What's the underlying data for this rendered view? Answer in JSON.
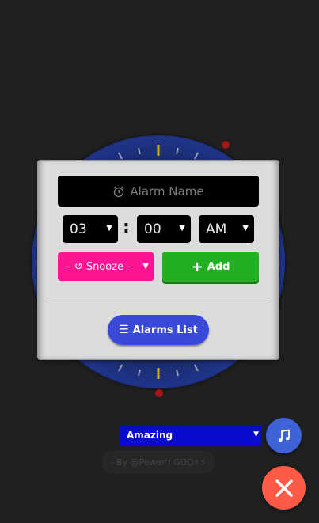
{
  "alarm_form": {
    "name_placeholder": "Alarm Name",
    "hour": "03",
    "separator": ":",
    "minute": "00",
    "period": "AM",
    "snooze_label": "- ↺ Snooze -",
    "add_label": "Add",
    "list_label": "Alarms List"
  },
  "music": {
    "selected_song": "Amazing"
  },
  "footer": {
    "credit": "- By @Power'f GOD⚡⚡"
  },
  "colors": {
    "snooze": "#ff1493",
    "add": "#22b022",
    "list": "#3a4ad8",
    "close": "#ff5a45",
    "song_select": "#0b0bd0"
  }
}
